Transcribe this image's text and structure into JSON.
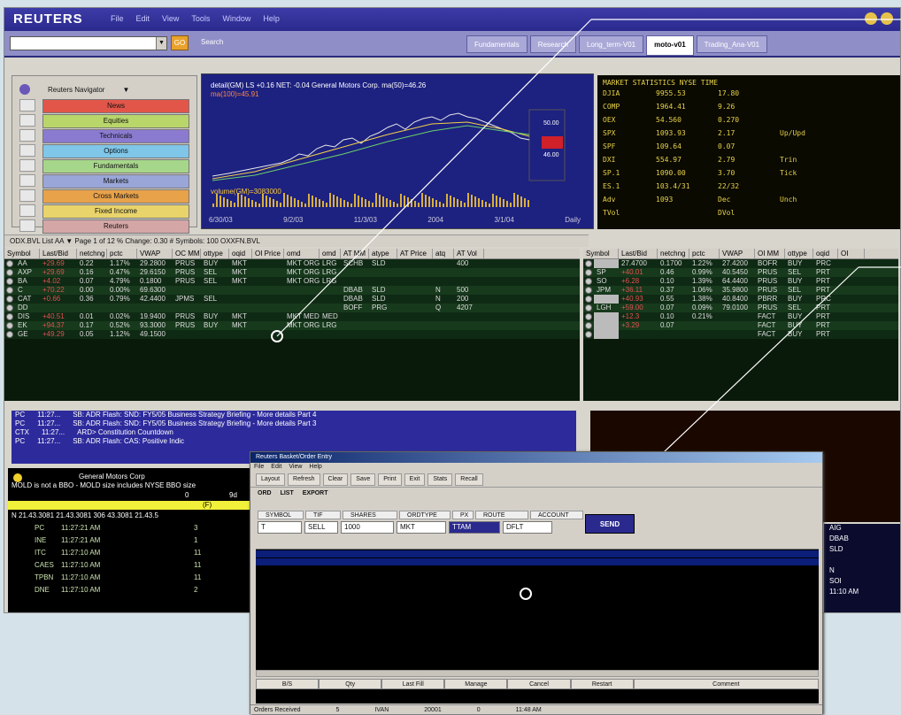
{
  "app": {
    "logo": "REUTERS",
    "menu": [
      "File",
      "Edit",
      "View",
      "Tools",
      "Window",
      "Help"
    ],
    "search_label": "Search",
    "tabs": [
      "Fundamentals",
      "Research",
      "Long_term-V01",
      "moto-v01",
      "Trading_Ana-V01"
    ],
    "active_tab": "moto-v01"
  },
  "navigator": {
    "title": "Reuters Navigator",
    "items": [
      {
        "label": "News",
        "color": "#e2564a"
      },
      {
        "label": "Equities",
        "color": "#b9d66a"
      },
      {
        "label": "Technicals",
        "color": "#8a7bd0"
      },
      {
        "label": "Options",
        "color": "#7fc6e8"
      },
      {
        "label": "Fundamentals",
        "color": "#a6d68a"
      },
      {
        "label": "Markets",
        "color": "#9aa6d8"
      },
      {
        "label": "Cross Markets",
        "color": "#e8a24a"
      },
      {
        "label": "Fixed Income",
        "color": "#e8d46a"
      },
      {
        "label": "Reuters",
        "color": "#d4a6a6"
      }
    ]
  },
  "chart": {
    "title": "detail(GM) LS +0.16 NET: -0.04  General Motors Corp. ma(50)=46.26",
    "subtitle": "ma(100)=45.91",
    "volume_label": "volume(GM)=3083000",
    "x_labels": [
      "6/30/03",
      "9/2/03",
      "11/3/03",
      "2004",
      "3/1/04",
      "Daily"
    ],
    "price_labels": [
      "50.00",
      "46.00"
    ]
  },
  "market_stats": {
    "header": "MARKET STATISTICS NYSE TIME",
    "rows": [
      {
        "sym": "DJIA",
        "v1": "9955.53",
        "v2": "17.80",
        "v3": ""
      },
      {
        "sym": "COMP",
        "v1": "1964.41",
        "v2": "9.26",
        "v3": ""
      },
      {
        "sym": "OEX",
        "v1": "54.560",
        "v2": "0.270",
        "v3": ""
      },
      {
        "sym": "SPX",
        "v1": "1093.93",
        "v2": "2.17",
        "v3": "Up/Upd"
      },
      {
        "sym": "SPF",
        "v1": "109.64",
        "v2": "0.07",
        "v3": ""
      },
      {
        "sym": "DXI",
        "v1": "554.97",
        "v2": "2.79",
        "v3": "Trin"
      },
      {
        "sym": "SP.1",
        "v1": "1090.00",
        "v2": "3.70",
        "v3": "Tick"
      },
      {
        "sym": "ES.1",
        "v1": "103.4/31",
        "v2": "22/32",
        "v3": ""
      },
      {
        "sym": "Adv",
        "v1": "1093",
        "v2": "Dec",
        "v3": "Unch"
      },
      {
        "sym": "TVol",
        "v1": "",
        "v2": "DVol",
        "v3": ""
      }
    ]
  },
  "filter_bar": "ODX.BVL List AA  ▼  Page 1 of 12  % Change: 0.30  # Symbols: 100  OXXFN.BVL",
  "grid_left": {
    "headers": [
      "Symbol",
      "Last/Bid",
      "netchng",
      "pctc",
      "VWAP",
      "OC MM",
      "ottype",
      "oqid",
      "OI Price",
      "omd",
      "omd",
      "AT MM",
      "atype",
      "AT Price",
      "atq",
      "AT Vol"
    ],
    "rows": [
      [
        "AA",
        "+29.69",
        "0.22",
        "1.17%",
        "29.2800",
        "PRUS",
        "BUY",
        "MKT",
        "",
        "MKT ORG",
        "LRG",
        "SCHB",
        "SLD",
        "",
        "",
        "400"
      ],
      [
        "AXP",
        "+29.69",
        "0.16",
        "0.47%",
        "29.6150",
        "PRUS",
        "SEL",
        "MKT",
        "",
        "MKT ORG",
        "LRG",
        "",
        "",
        "",
        "",
        ""
      ],
      [
        "BA",
        "+4.02",
        "0.07",
        "4.79%",
        "0.1800",
        "PRUS",
        "SEL",
        "MKT",
        "",
        "MKT ORG",
        "LRG",
        "",
        "",
        "",
        "",
        ""
      ],
      [
        "C",
        "+70.22",
        "0.00",
        "0.00%",
        "69.6300",
        "",
        "",
        "",
        "",
        "",
        "",
        "DBAB",
        "SLD",
        "",
        "N",
        "500"
      ],
      [
        "CAT",
        "+0.66",
        "0.36",
        "0.79%",
        "42.4400",
        "JPMS",
        "SEL",
        "",
        "",
        "",
        "",
        "DBAB",
        "SLD",
        "",
        "N",
        "200"
      ],
      [
        "DD",
        "",
        "",
        "",
        "",
        "",
        "",
        "",
        "",
        "",
        "",
        "BOFF",
        "PRG",
        "",
        "Q",
        "4207"
      ],
      [
        "DIS",
        "+40.51",
        "0.01",
        "0.02%",
        "19.9400",
        "PRUS",
        "BUY",
        "MKT",
        "",
        "MKT MED",
        "MED",
        "",
        "",
        "",
        "",
        ""
      ],
      [
        "EK",
        "+94.37",
        "0.17",
        "0.52%",
        "93.3000",
        "PRUS",
        "BUY",
        "MKT",
        "",
        "MKT ORG",
        "LRG",
        "",
        "",
        "",
        "",
        ""
      ],
      [
        "GE",
        "+49.29",
        "0.05",
        "1.12%",
        "49.1500",
        "",
        "",
        "",
        "",
        "",
        "",
        "",
        "",
        "",
        "",
        ""
      ]
    ]
  },
  "grid_right": {
    "headers": [
      "Symbol",
      "Last/Bid",
      "netchng",
      "pctc",
      "VWAP",
      "OI MM",
      "ottype",
      "oqid",
      "OI"
    ],
    "rows": [
      [
        "",
        "27.4700",
        "0.1700",
        "1.22%",
        "27.4200",
        "BOFR",
        "BUY",
        "PRC",
        ""
      ],
      [
        "SP",
        "+40.01",
        "0.46",
        "0.99%",
        "40.5450",
        "PRUS",
        "SEL",
        "PRT",
        ""
      ],
      [
        "SO",
        "+6.28",
        "0.10",
        "1.39%",
        "64.4400",
        "PRUS",
        "BUY",
        "PRT",
        ""
      ],
      [
        "JPM",
        "+36.11",
        "0.37",
        "1.06%",
        "35.9800",
        "PRUS",
        "SEL",
        "PRT",
        ""
      ],
      [
        "",
        "+40.93",
        "0.55",
        "1.38%",
        "40.8400",
        "PBRR",
        "BUY",
        "PRC",
        ""
      ],
      [
        "LGH",
        "+59.00",
        "0.07",
        "0.09%",
        "79.0100",
        "PRUS",
        "SEL",
        "PRT",
        ""
      ],
      [
        "",
        "+12.3",
        "0.10",
        "0.21%",
        "",
        "FACT",
        "BUY",
        "PRT",
        ""
      ],
      [
        "",
        "+3.29",
        "0.07",
        "",
        "",
        "FACT",
        "BUY",
        "PRT",
        ""
      ],
      [
        "",
        "",
        "",
        "",
        "",
        "FACT",
        "BUY",
        "PRT",
        ""
      ]
    ]
  },
  "news": [
    {
      "src": "PC",
      "time": "11:27...",
      "text": "SB: ADR Flash: SND: FY5/05 Business Strategy Briefing - More details Part 4"
    },
    {
      "src": "PC",
      "time": "11:27...",
      "text": "SB: ADR Flash: SND: FY5/05 Business Strategy Briefing - More details Part 3"
    },
    {
      "src": "CTX",
      "time": "11:27...",
      "text": "ARD> Constitution Countdown"
    },
    {
      "src": "PC",
      "time": "11:27...",
      "text": "SB: ADR Flash: CAS: Positive Indic"
    }
  ],
  "time_sales": {
    "title": "General Motors Corp",
    "note": "MOLD is not a BBO - MOLD size includes NYSE BBO size",
    "stats": [
      "0",
      "9d"
    ],
    "quote": "N  21.43.3081  21.43.3081  306 43.3081  21.43.5",
    "yellow_label": "(F)",
    "rows": [
      {
        "ex": "PC",
        "time": "11:27:21 AM",
        "size": "3"
      },
      {
        "ex": "INE",
        "time": "11:27:21 AM",
        "size": "1"
      },
      {
        "ex": "ITC",
        "time": "11:27:10 AM",
        "size": "11"
      },
      {
        "ex": "CAES",
        "time": "11:27:10 AM",
        "size": "11"
      },
      {
        "ex": "TPBN",
        "time": "11:27:10 AM",
        "size": "11"
      },
      {
        "ex": "DNE",
        "time": "11:27:10 AM",
        "size": "2"
      }
    ]
  },
  "right_bottom": {
    "rows": [
      "AIG",
      "DBAB",
      "SLD",
      "",
      "N",
      "SOI",
      "11:10 AM"
    ]
  },
  "order_dialog": {
    "title": "Reuters Basket/Order Entry",
    "menu": [
      "File",
      "Edit",
      "View",
      "Help"
    ],
    "toolbar": [
      "Layout",
      "Refresh",
      "Clear",
      "Save",
      "Print",
      "Exit",
      "Stats",
      "Recall"
    ],
    "tabs": [
      "ORD",
      "LIST",
      "EXPORT"
    ],
    "field_headers": [
      "SYMBOL",
      "TIF",
      "SHARES",
      "ORDTYPE",
      "PX",
      "ROUTE",
      "ACCOUNT"
    ],
    "field_values": [
      "T",
      "SELL",
      "1000",
      "MKT",
      "TTAM",
      "DFLT"
    ],
    "send_label": "SEND",
    "bottom_buttons": [
      "B/S",
      "Qty",
      "Last Fill",
      "Manage",
      "Cancel",
      "Restart",
      "Comment"
    ],
    "status": [
      "Orders Received",
      "5",
      "IVAN",
      "20001",
      "0",
      "11:48 AM"
    ]
  }
}
